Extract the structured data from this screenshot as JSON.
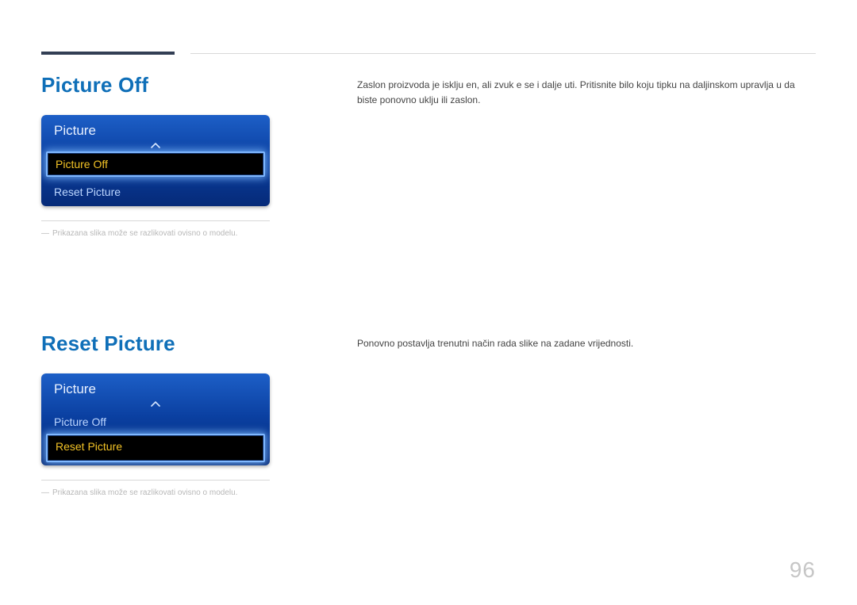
{
  "page_number": "96",
  "sections": [
    {
      "heading": "Picture Off",
      "description": "Zaslon proizvoda je isklju en, ali zvuk  e se i dalje  uti. Pritisnite bilo koju tipku na daljinskom upravlja u da biste ponovno uklju ili zaslon.",
      "menu": {
        "title": "Picture",
        "items": [
          {
            "label": "Picture Off",
            "selected": true
          },
          {
            "label": "Reset Picture",
            "selected": false
          }
        ]
      },
      "footnote": "Prikazana slika može se razlikovati ovisno o modelu."
    },
    {
      "heading": "Reset Picture",
      "description": "Ponovno postavlja trenutni način rada slike na zadane vrijednosti.",
      "menu": {
        "title": "Picture",
        "items": [
          {
            "label": "Picture Off",
            "selected": false
          },
          {
            "label": "Reset Picture",
            "selected": true
          }
        ]
      },
      "footnote": "Prikazana slika može se razlikovati ovisno o modelu."
    }
  ]
}
